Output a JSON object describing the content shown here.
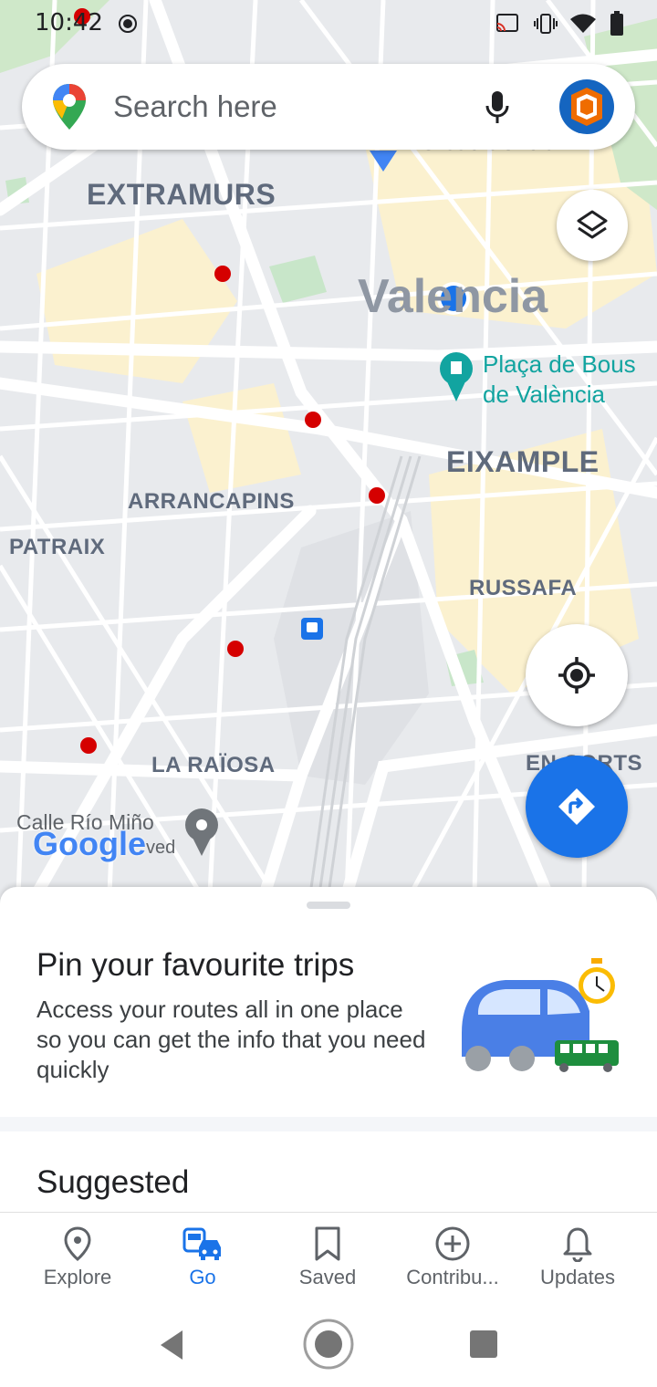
{
  "status_bar": {
    "time": "10:42"
  },
  "search": {
    "placeholder": "Search here"
  },
  "map": {
    "labels": {
      "extramurs": "EXTRAMURS",
      "valencia": "Valencia",
      "placa": "Plaça de Bous",
      "placa2": "de València",
      "eixample": "EIXAMPLE",
      "arrancapins": "ARRANCAPINS",
      "patraix": "PATRAIX",
      "russafa": "RUSSAFA",
      "la_raiosa": "LA RAÏOSA",
      "en_corts": "EN CORTS",
      "calle_rio": "Calle Río Miño",
      "mercat": "Mercat Central",
      "ved": "ved"
    },
    "google_logo": "Google"
  },
  "sheet": {
    "title": "Pin your favourite trips",
    "body": "Access your routes all in one place so you can get the info that you need quickly",
    "suggested": "Suggested"
  },
  "bottom_nav": {
    "items": [
      {
        "label": "Explore",
        "icon": "location-pin-icon"
      },
      {
        "label": "Go",
        "icon": "car-transit-icon",
        "active": true
      },
      {
        "label": "Saved",
        "icon": "bookmark-icon"
      },
      {
        "label": "Contribu...",
        "icon": "add-circle-icon"
      },
      {
        "label": "Updates",
        "icon": "bell-icon"
      }
    ]
  },
  "colors": {
    "accent": "#1a73e8",
    "metro": "#d50000",
    "transit": "#188038"
  }
}
